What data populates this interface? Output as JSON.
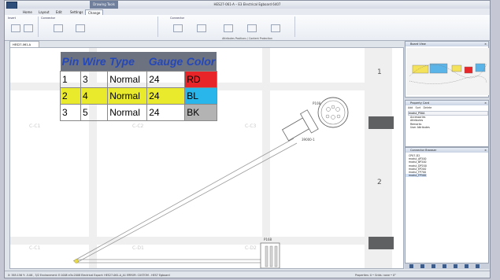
{
  "app": {
    "title": "HES27-061-A – E3 Electrical Egboard 6407",
    "quick_access": [
      "save-icon",
      "undo-icon",
      "redo-icon"
    ],
    "contextual_tab": "Drawing Tools",
    "window_buttons": [
      "–",
      "□",
      "×"
    ]
  },
  "ribbon": {
    "tabs": [
      "Home",
      "Layout",
      "Edit",
      "Settings",
      "Change"
    ],
    "active_tab": "Change",
    "groups": [
      "Insert",
      "Connector",
      "",
      "Connector",
      ""
    ],
    "attribute_strip": "Attributes Positions / Content Protection"
  },
  "document": {
    "tab_label": "HES27-061-A"
  },
  "canvas": {
    "zones": [
      "C-C1",
      "C-C2",
      "C-C3",
      "C-C1",
      "C-D1",
      "C-D2"
    ],
    "row_numbers": [
      "1",
      "2"
    ],
    "connector_labels": [
      "P108",
      "39000-1",
      "P168"
    ]
  },
  "pin_table": {
    "headers": [
      "Pin",
      "Wire",
      "Type",
      "Gauge",
      "Color"
    ],
    "rows": [
      {
        "pin": "1",
        "wire": "3",
        "type": "Normal",
        "gauge": "24",
        "color": "RD",
        "color_hex": "#e8262a",
        "row_bg": "#ffffff"
      },
      {
        "pin": "2",
        "wire": "4",
        "type": "Normal",
        "gauge": "24",
        "color": "BL",
        "color_hex": "#29b6ea",
        "row_bg": "#eaea2c"
      },
      {
        "pin": "3",
        "wire": "5",
        "type": "Normal",
        "gauge": "24",
        "color": "BK",
        "color_hex": "#b3b3b3",
        "row_bg": "#ffffff"
      }
    ],
    "header_bg": "#6d7280",
    "header_text": "#2548b8"
  },
  "panels": {
    "board_view": {
      "title": "Board View"
    },
    "property_card": {
      "title": "Property Card",
      "toolbar": [
        "Add",
        "Sort",
        "Delete"
      ],
      "selected": "modul_P50A",
      "rows": [
        "Accessories",
        "Attributes",
        "Remarks",
        "User Attributes"
      ]
    },
    "connector_browser": {
      "title": "Connector Browser",
      "items": [
        "CP07-D2",
        "modul_AP200",
        "modul_BP200",
        "modul_DP200",
        "modul_EP200",
        "modul_FP700",
        "modul_FP500"
      ],
      "selected": "modul_FP500"
    }
  },
  "status": {
    "left": "X: 385.156 Y: -5.06 , 3/2 Environment: E:1008 e3s:2008 Electrical Export: HES27-061-A_A1 ERROR: CUSTOM - HES7 Egboard",
    "right": "Properties: 0 • Grids: none • 0°"
  },
  "colors": {
    "accent": "#2f4f7a",
    "table_border": "#888888"
  }
}
